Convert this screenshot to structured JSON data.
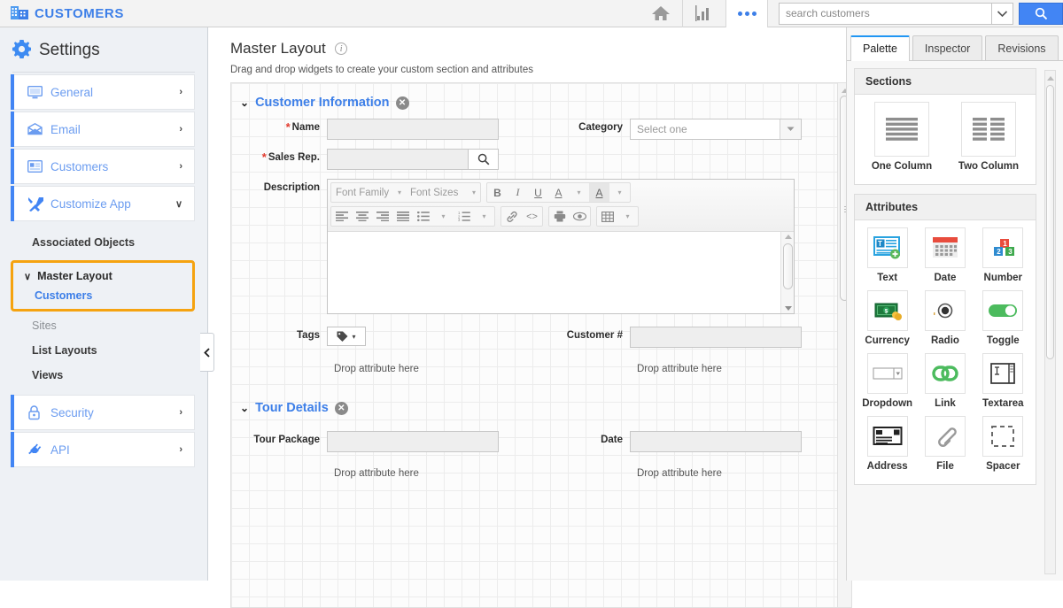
{
  "topbar": {
    "brand_icon": "building-icon",
    "brand_title": "CUSTOMERS",
    "home_icon": "home-icon",
    "reports_icon": "bar-chart-icon",
    "more_icon": "more-dots-icon",
    "search_placeholder": "search customers",
    "search_value": "",
    "search_caret_icon": "chevron-down-icon",
    "search_button_icon": "search-icon",
    "accent_color": "#4285f4"
  },
  "sidebar": {
    "gear_icon": "gear-icon",
    "title": "Settings",
    "items": [
      {
        "label": "General",
        "icon": "monitor-icon",
        "chevron": "›"
      },
      {
        "label": "Email",
        "icon": "envelope-icon",
        "chevron": "›"
      },
      {
        "label": "Customers",
        "icon": "card-icon",
        "chevron": "›"
      },
      {
        "label": "Customize App",
        "icon": "tools-icon",
        "chevron": "∨"
      }
    ],
    "sub_items": [
      {
        "label": "Associated Objects",
        "style": "bold"
      }
    ],
    "highlight": {
      "border_color": "#f5a310",
      "parent_label": "Master Layout",
      "parent_caret": "∨",
      "child_label": "Customers"
    },
    "after_highlight": [
      {
        "label": "Sites",
        "style": "gray"
      },
      {
        "label": "List Layouts",
        "style": "bold"
      },
      {
        "label": "Views",
        "style": "bold"
      }
    ],
    "bottom_items": [
      {
        "label": "Security",
        "icon": "lock-icon",
        "chevron": "›"
      },
      {
        "label": "API",
        "icon": "plug-icon",
        "chevron": "›"
      }
    ],
    "collapse_handle_icon": "chevron-left-icon"
  },
  "page": {
    "title": "Master Layout",
    "info_icon": "info-icon",
    "subtitle": "Drag and drop widgets to create your custom section and attributes"
  },
  "sections": [
    {
      "caret": "⌄",
      "title": "Customer Information",
      "close_icon": "close-circle-icon",
      "close_glyph": "✕",
      "fields": {
        "name_label": "Name",
        "name_required": "*",
        "name_value": "",
        "category_label": "Category",
        "category_value": "Select one",
        "category_caret_icon": "chevron-down-icon",
        "salesrep_label": "Sales Rep.",
        "salesrep_required": "*",
        "salesrep_value": "",
        "salesrep_search_icon": "search-icon",
        "description_label": "Description",
        "tags_label": "Tags",
        "tags_icon": "tag-icon",
        "tags_caret": "▾",
        "customer_num_label": "Customer #",
        "customer_num_value": "",
        "drop_hint_left": "Drop attribute here",
        "drop_hint_right": "Drop attribute here"
      }
    },
    {
      "caret": "⌄",
      "title": "Tour Details",
      "close_icon": "close-circle-icon",
      "close_glyph": "✕",
      "fields": {
        "tour_package_label": "Tour Package",
        "tour_package_value": "",
        "date_label": "Date",
        "date_value": "",
        "drop_hint_left": "Drop attribute here",
        "drop_hint_right": "Drop attribute here"
      }
    }
  ],
  "editor": {
    "font_family_label": "Font Family",
    "font_sizes_label": "Font Sizes",
    "bold": "B",
    "italic": "I",
    "underline": "U",
    "forecolor": "A",
    "backcolor": "A",
    "align_left_icon": "align-left-icon",
    "align_center_icon": "align-center-icon",
    "align_right_icon": "align-right-icon",
    "align_justify_icon": "align-justify-icon",
    "bullet_list_icon": "bullet-list-icon",
    "number_list_icon": "numbered-list-icon",
    "link_icon": "link-icon",
    "code_icon": "code-icon",
    "print_icon": "print-icon",
    "preview_icon": "eye-icon",
    "table_icon": "table-icon",
    "content": ""
  },
  "right_panel": {
    "tabs": [
      {
        "label": "Palette",
        "active": true
      },
      {
        "label": "Inspector",
        "active": false
      },
      {
        "label": "Revisions",
        "active": false
      }
    ],
    "sections_card": {
      "title": "Sections",
      "tiles": [
        {
          "label": "One Column",
          "icon": "one-column-icon"
        },
        {
          "label": "Two Column",
          "icon": "two-column-icon"
        }
      ]
    },
    "attributes_card": {
      "title": "Attributes",
      "tiles": [
        {
          "label": "Text",
          "icon": "text-field-icon"
        },
        {
          "label": "Date",
          "icon": "calendar-icon"
        },
        {
          "label": "Number",
          "icon": "number-blocks-icon"
        },
        {
          "label": "Currency",
          "icon": "money-icon"
        },
        {
          "label": "Radio",
          "icon": "radio-button-icon"
        },
        {
          "label": "Toggle",
          "icon": "toggle-switch-icon"
        },
        {
          "label": "Dropdown",
          "icon": "dropdown-icon"
        },
        {
          "label": "Link",
          "icon": "chain-link-icon"
        },
        {
          "label": "Textarea",
          "icon": "textarea-icon"
        },
        {
          "label": "Address",
          "icon": "address-card-icon"
        },
        {
          "label": "File",
          "icon": "paperclip-icon"
        },
        {
          "label": "Spacer",
          "icon": "dashed-square-icon"
        }
      ]
    }
  }
}
